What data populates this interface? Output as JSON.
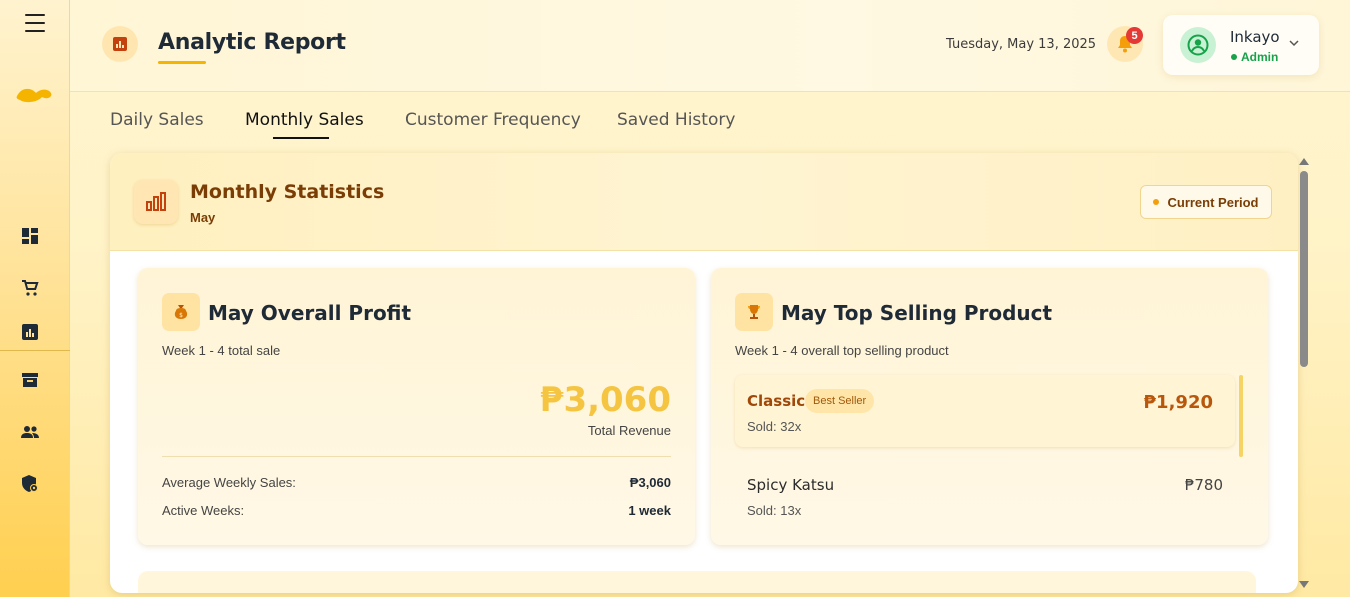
{
  "header": {
    "title": "Analytic Report",
    "date": "Tuesday, May 13, 2025",
    "notification_count": "5",
    "user": {
      "name": "Inkayo",
      "role": "Admin"
    }
  },
  "sidebar": {
    "items": [
      {
        "name": "dashboard",
        "icon": "dashboard-icon"
      },
      {
        "name": "orders",
        "icon": "cart-icon"
      },
      {
        "name": "analytics",
        "icon": "report-icon"
      },
      {
        "name": "inventory",
        "icon": "archive-icon"
      },
      {
        "name": "users",
        "icon": "people-icon"
      },
      {
        "name": "security",
        "icon": "shield-icon"
      }
    ]
  },
  "tabs": [
    {
      "label": "Daily Sales",
      "active": false
    },
    {
      "label": "Monthly Sales",
      "active": true
    },
    {
      "label": "Customer Frequency",
      "active": false
    },
    {
      "label": "Saved History",
      "active": false
    }
  ],
  "stats": {
    "title": "Monthly Statistics",
    "month": "May",
    "period_label": "Current Period"
  },
  "profit_card": {
    "title": "May Overall Profit",
    "subtitle": "Week 1 - 4 total sale",
    "total": "₱3,060",
    "total_caption": "Total Revenue",
    "rows": [
      {
        "label": "Average Weekly Sales:",
        "value": "₱3,060"
      },
      {
        "label": "Active Weeks:",
        "value": "1 week"
      }
    ]
  },
  "top_card": {
    "title": "May Top Selling Product",
    "subtitle": "Week 1 - 4 overall top selling product",
    "products": [
      {
        "name": "Classic",
        "badge": "Best Seller",
        "price": "₱1,920",
        "sold": "Sold: 32x"
      },
      {
        "name": "Spicy Katsu",
        "price": "₱780",
        "sold": "Sold: 13x"
      }
    ]
  },
  "colors": {
    "accent": "#f4b400",
    "brand_brown": "#7a3d05",
    "success": "#16a34a",
    "badge_red": "#e53935"
  }
}
